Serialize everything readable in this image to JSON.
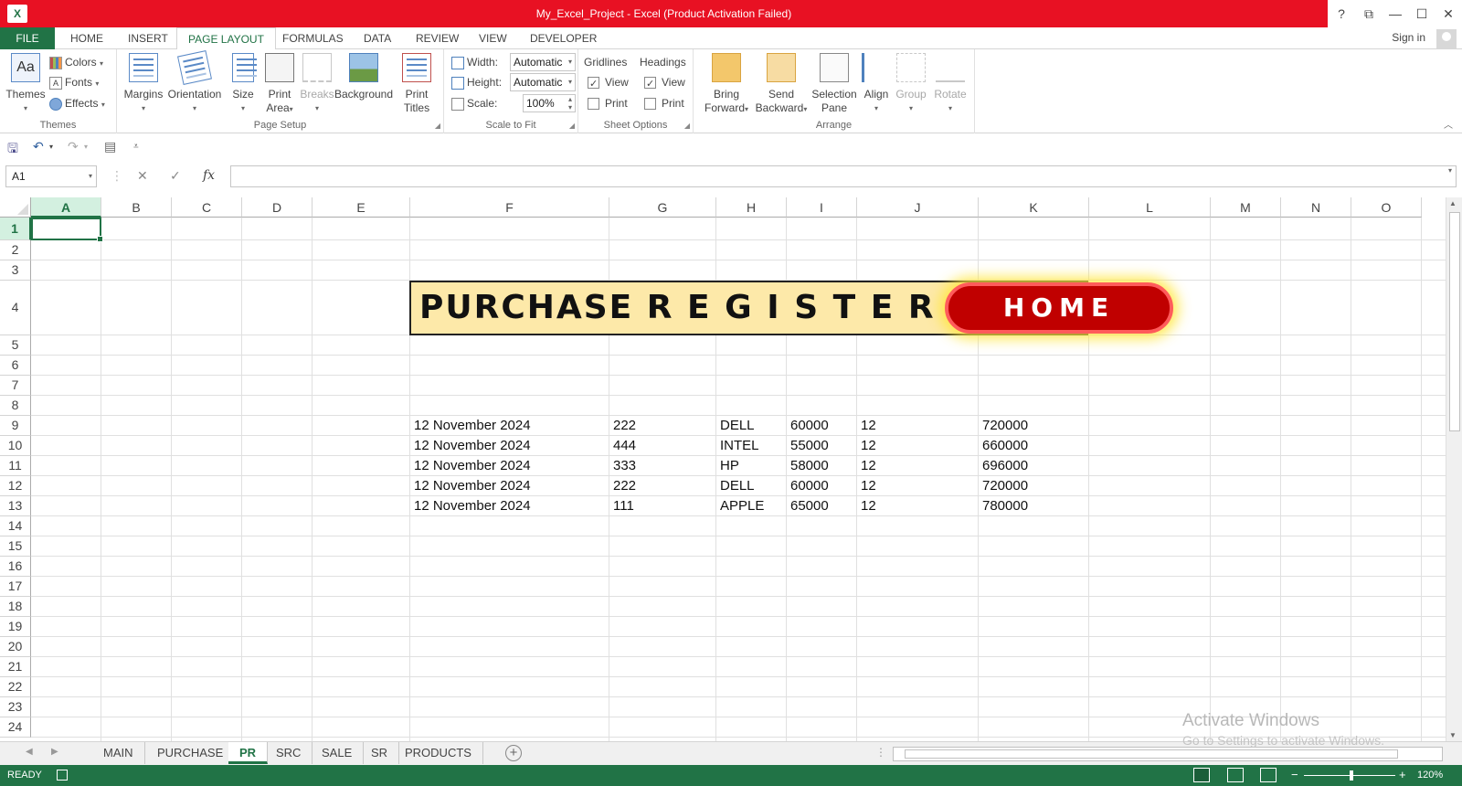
{
  "title": {
    "app_badge": "X",
    "text": "My_Excel_Project -  Excel (Product Activation Failed)",
    "help": "?",
    "ribbon_display": "⧉",
    "minimize": "—",
    "maximize": "☐",
    "close": "✕"
  },
  "tabs": [
    "FILE",
    "HOME",
    "INSERT",
    "PAGE LAYOUT",
    "FORMULAS",
    "DATA",
    "REVIEW",
    "VIEW",
    "DEVELOPER"
  ],
  "active_tab": "PAGE LAYOUT",
  "signin": "Sign in",
  "ribbon": {
    "themes_group": {
      "label": "Themes",
      "themes_btn": "Themes",
      "colors": "Colors",
      "fonts": "Fonts",
      "effects": "Effects"
    },
    "page_setup_group": {
      "label": "Page Setup",
      "margins": "Margins",
      "orientation": "Orientation",
      "size": "Size",
      "print_area_1": "Print",
      "print_area_2": "Area",
      "breaks": "Breaks",
      "background": "Background",
      "print_titles_1": "Print",
      "print_titles_2": "Titles"
    },
    "scale_group": {
      "label": "Scale to Fit",
      "width_label": "Width:",
      "width_value": "Automatic",
      "height_label": "Height:",
      "height_value": "Automatic",
      "scale_label": "Scale:",
      "scale_value": "100%"
    },
    "sheet_options_group": {
      "label": "Sheet Options",
      "gridlines": "Gridlines",
      "headings": "Headings",
      "view": "View",
      "print": "Print",
      "gridlines_view": true,
      "gridlines_print": false,
      "headings_view": true,
      "headings_print": false
    },
    "arrange_group": {
      "label": "Arrange",
      "bring_forward_1": "Bring",
      "bring_forward_2": "Forward",
      "send_backward_1": "Send",
      "send_backward_2": "Backward",
      "selection_pane_1": "Selection",
      "selection_pane_2": "Pane",
      "align": "Align",
      "group": "Group",
      "rotate": "Rotate"
    }
  },
  "formula_bar": {
    "name_box": "A1",
    "cancel": "✕",
    "enter": "✓",
    "fx": "fx",
    "formula": ""
  },
  "columns": [
    "A",
    "B",
    "C",
    "D",
    "E",
    "F",
    "G",
    "H",
    "I",
    "J",
    "K",
    "L",
    "M",
    "N",
    "O"
  ],
  "rows": [
    "1",
    "2",
    "3",
    "4",
    "5",
    "6",
    "7",
    "8",
    "9",
    "10",
    "11",
    "12",
    "13",
    "14",
    "15",
    "16",
    "17",
    "18",
    "19",
    "20",
    "21",
    "22",
    "23",
    "24"
  ],
  "selected_cell": "A1",
  "banner": {
    "text": "PURCHASE  R E G I S T E R",
    "home_button": "HOME"
  },
  "table_rows": [
    [
      "12 November 2024",
      "222",
      "DELL",
      "60000",
      "12",
      "720000"
    ],
    [
      "12 November 2024",
      "444",
      "INTEL",
      "55000",
      "12",
      "660000"
    ],
    [
      "12 November 2024",
      "333",
      "HP",
      "58000",
      "12",
      "696000"
    ],
    [
      "12 November 2024",
      "222",
      "DELL",
      "60000",
      "12",
      "720000"
    ],
    [
      "12 November 2024",
      "111",
      "APPLE",
      "65000",
      "12",
      "780000"
    ]
  ],
  "sheet_tabs": [
    "MAIN",
    "PURCHASE",
    "PR",
    "SRC",
    "SALE",
    "SR",
    "PRODUCTS"
  ],
  "active_sheet": "PR",
  "watermark": {
    "line1": "Activate Windows",
    "line2": "Go to Settings to activate Windows."
  },
  "status": {
    "ready": "READY",
    "zoom": "120%",
    "zoom_level": 120
  },
  "colors": {
    "title_red": "#e81123",
    "excel_green": "#217346",
    "banner_fill": "#fde9a9",
    "home_red": "#c00000"
  }
}
